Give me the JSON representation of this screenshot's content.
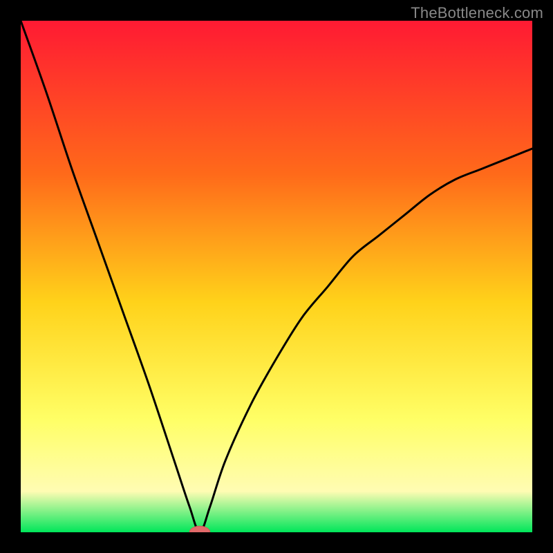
{
  "watermark": "TheBottleneck.com",
  "colors": {
    "frame": "#000000",
    "gradient_top": "#ff1a33",
    "gradient_mid1": "#ff6a1a",
    "gradient_mid2": "#ffd21a",
    "gradient_mid3": "#ffff66",
    "gradient_mid4": "#fffcb3",
    "gradient_bottom": "#00e65a",
    "curve": "#000000",
    "marker_fill": "#e26a6a",
    "marker_stroke": "#d05a5a"
  },
  "chart_data": {
    "type": "line",
    "title": "",
    "xlabel": "",
    "ylabel": "",
    "xlim": [
      0,
      100
    ],
    "ylim": [
      0,
      100
    ],
    "grid": false,
    "legend": false,
    "minimum_at_x": 35,
    "series": [
      {
        "name": "bottleneck-curve",
        "x": [
          0,
          5,
          10,
          15,
          20,
          25,
          30,
          33,
          35,
          37,
          40,
          45,
          50,
          55,
          60,
          65,
          70,
          75,
          80,
          85,
          90,
          95,
          100
        ],
        "y": [
          100,
          86,
          71,
          57,
          43,
          29,
          14,
          5,
          0,
          5,
          14,
          25,
          34,
          42,
          48,
          54,
          58,
          62,
          66,
          69,
          71,
          73,
          75
        ]
      }
    ],
    "marker": {
      "x": 35,
      "y": 0,
      "rx": 2.0,
      "ry": 1.2
    }
  }
}
